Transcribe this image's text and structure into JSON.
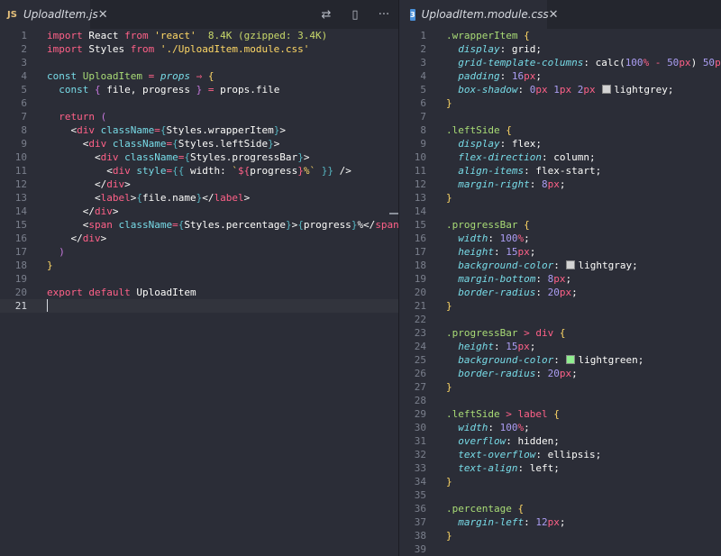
{
  "left_tab": {
    "icon": "JS",
    "name": "UploadItem.js",
    "close": "✕"
  },
  "left_actions": {
    "compare_icon": "⇄",
    "split_icon": "▯",
    "more_icon": "···"
  },
  "right_tab": {
    "icon": "3",
    "name": "UploadItem.module.css",
    "close": "✕"
  },
  "colors": {
    "lightgrey": "#d3d3d3",
    "lightgray": "#d3d3d3",
    "lightgreen": "#90ee90"
  },
  "left_lines": [
    {
      "n": "1",
      "parts": [
        [
          "kw",
          "import"
        ],
        [
          "id",
          " React "
        ],
        [
          "kw",
          "from"
        ],
        [
          "str",
          " 'react'"
        ],
        [
          "cm",
          "  8.4K (gzipped: 3.4K)"
        ]
      ]
    },
    {
      "n": "2",
      "parts": [
        [
          "kw",
          "import"
        ],
        [
          "id",
          " Styles "
        ],
        [
          "kw",
          "from"
        ],
        [
          "str",
          " './UploadItem.module.css'"
        ]
      ]
    },
    {
      "n": "3",
      "parts": []
    },
    {
      "n": "4",
      "parts": [
        [
          "attr",
          "const"
        ],
        [
          "fn",
          " UploadItem "
        ],
        [
          "op",
          "="
        ],
        [
          "prop",
          " props"
        ],
        [
          "op",
          " ⇒ "
        ],
        [
          "brace",
          "{"
        ]
      ]
    },
    {
      "n": "5",
      "parts": [
        [
          "id",
          "  "
        ],
        [
          "attr",
          "const"
        ],
        [
          "brace2",
          " { "
        ],
        [
          "id",
          "file, progress"
        ],
        [
          "brace2",
          " } "
        ],
        [
          "op",
          "="
        ],
        [
          "id",
          " props.file"
        ]
      ]
    },
    {
      "n": "6",
      "parts": []
    },
    {
      "n": "7",
      "parts": [
        [
          "id",
          "  "
        ],
        [
          "kw",
          "return"
        ],
        [
          "brace2",
          " ("
        ]
      ]
    },
    {
      "n": "8",
      "parts": [
        [
          "id",
          "    "
        ],
        [
          "id",
          "<"
        ],
        [
          "tag",
          "div"
        ],
        [
          "attr",
          " className"
        ],
        [
          "op",
          "="
        ],
        [
          "brace3",
          "{"
        ],
        [
          "id",
          "Styles.wrapperItem"
        ],
        [
          "brace3",
          "}"
        ],
        [
          "id",
          ">"
        ]
      ]
    },
    {
      "n": "9",
      "parts": [
        [
          "id",
          "      "
        ],
        [
          "id",
          "<"
        ],
        [
          "tag",
          "div"
        ],
        [
          "attr",
          " className"
        ],
        [
          "op",
          "="
        ],
        [
          "brace3",
          "{"
        ],
        [
          "id",
          "Styles.leftSide"
        ],
        [
          "brace3",
          "}"
        ],
        [
          "id",
          ">"
        ]
      ]
    },
    {
      "n": "10",
      "parts": [
        [
          "id",
          "        "
        ],
        [
          "id",
          "<"
        ],
        [
          "tag",
          "div"
        ],
        [
          "attr",
          " className"
        ],
        [
          "op",
          "="
        ],
        [
          "brace3",
          "{"
        ],
        [
          "id",
          "Styles.progressBar"
        ],
        [
          "brace3",
          "}"
        ],
        [
          "id",
          ">"
        ]
      ]
    },
    {
      "n": "11",
      "parts": [
        [
          "id",
          "          "
        ],
        [
          "id",
          "<"
        ],
        [
          "tag",
          "div"
        ],
        [
          "attr",
          " style"
        ],
        [
          "op",
          "="
        ],
        [
          "brace3",
          "{{"
        ],
        [
          "id",
          " width: "
        ],
        [
          "str",
          "`"
        ],
        [
          "op",
          "${"
        ],
        [
          "id",
          "progress"
        ],
        [
          "op",
          "}"
        ],
        [
          "str",
          "%`"
        ],
        [
          "brace3",
          " }}"
        ],
        [
          "id",
          " />"
        ]
      ]
    },
    {
      "n": "12",
      "parts": [
        [
          "id",
          "        "
        ],
        [
          "id",
          "</"
        ],
        [
          "tag",
          "div"
        ],
        [
          "id",
          ">"
        ]
      ]
    },
    {
      "n": "13",
      "parts": [
        [
          "id",
          "        "
        ],
        [
          "id",
          "<"
        ],
        [
          "tag",
          "label"
        ],
        [
          "id",
          ">"
        ],
        [
          "brace3",
          "{"
        ],
        [
          "id",
          "file.name"
        ],
        [
          "brace3",
          "}"
        ],
        [
          "id",
          "</"
        ],
        [
          "tag",
          "label"
        ],
        [
          "id",
          ">"
        ]
      ]
    },
    {
      "n": "14",
      "parts": [
        [
          "id",
          "      "
        ],
        [
          "id",
          "</"
        ],
        [
          "tag",
          "div"
        ],
        [
          "id",
          ">"
        ]
      ]
    },
    {
      "n": "15",
      "parts": [
        [
          "id",
          "      "
        ],
        [
          "id",
          "<"
        ],
        [
          "tag",
          "span"
        ],
        [
          "attr",
          " className"
        ],
        [
          "op",
          "="
        ],
        [
          "brace3",
          "{"
        ],
        [
          "id",
          "Styles.percentage"
        ],
        [
          "brace3",
          "}"
        ],
        [
          "id",
          ">"
        ],
        [
          "brace3",
          "{"
        ],
        [
          "id",
          "progress"
        ],
        [
          "brace3",
          "}"
        ],
        [
          "id",
          "%</"
        ],
        [
          "tag",
          "span"
        ],
        [
          "id",
          ">"
        ]
      ]
    },
    {
      "n": "16",
      "parts": [
        [
          "id",
          "    "
        ],
        [
          "id",
          "</"
        ],
        [
          "tag",
          "div"
        ],
        [
          "id",
          ">"
        ]
      ]
    },
    {
      "n": "17",
      "parts": [
        [
          "id",
          "  "
        ],
        [
          "brace2",
          ")"
        ]
      ]
    },
    {
      "n": "18",
      "parts": [
        [
          "brace",
          "}"
        ]
      ]
    },
    {
      "n": "19",
      "parts": []
    },
    {
      "n": "20",
      "parts": [
        [
          "kw",
          "export"
        ],
        [
          "kw",
          " default"
        ],
        [
          "id",
          " UploadItem"
        ]
      ]
    },
    {
      "n": "21",
      "parts": [],
      "active": true
    }
  ],
  "right_lines": [
    {
      "n": "1",
      "parts": [
        [
          "sel",
          ".wrapperItem"
        ],
        [
          "brace",
          " {"
        ]
      ]
    },
    {
      "n": "2",
      "parts": [
        [
          "id",
          "  "
        ],
        [
          "prop",
          "display"
        ],
        [
          "id",
          ": grid;"
        ]
      ]
    },
    {
      "n": "3",
      "parts": [
        [
          "id",
          "  "
        ],
        [
          "prop",
          "grid-template-columns"
        ],
        [
          "id",
          ": calc("
        ],
        [
          "num",
          "100"
        ],
        [
          "unit",
          "%"
        ],
        [
          "op",
          " - "
        ],
        [
          "num",
          "50"
        ],
        [
          "unit",
          "px"
        ],
        [
          "id",
          ") "
        ],
        [
          "num",
          "50"
        ],
        [
          "unit",
          "px"
        ],
        [
          "id",
          ";"
        ]
      ]
    },
    {
      "n": "4",
      "parts": [
        [
          "id",
          "  "
        ],
        [
          "prop",
          "padding"
        ],
        [
          "id",
          ": "
        ],
        [
          "num",
          "16"
        ],
        [
          "unit",
          "px"
        ],
        [
          "id",
          ";"
        ]
      ]
    },
    {
      "n": "5",
      "parts": [
        [
          "id",
          "  "
        ],
        [
          "prop",
          "box-shadow"
        ],
        [
          "id",
          ": "
        ],
        [
          "num",
          "0"
        ],
        [
          "unit",
          "px"
        ],
        [
          "id",
          " "
        ],
        [
          "num",
          "1"
        ],
        [
          "unit",
          "px"
        ],
        [
          "id",
          " "
        ],
        [
          "num",
          "2"
        ],
        [
          "unit",
          "px"
        ],
        [
          "id",
          " "
        ],
        [
          "swatch",
          "lightgrey"
        ],
        [
          "id",
          "lightgrey;"
        ]
      ]
    },
    {
      "n": "6",
      "parts": [
        [
          "brace",
          "}"
        ]
      ]
    },
    {
      "n": "7",
      "parts": []
    },
    {
      "n": "8",
      "parts": [
        [
          "sel",
          ".leftSide"
        ],
        [
          "brace",
          " {"
        ]
      ]
    },
    {
      "n": "9",
      "parts": [
        [
          "id",
          "  "
        ],
        [
          "prop",
          "display"
        ],
        [
          "id",
          ": flex;"
        ]
      ]
    },
    {
      "n": "10",
      "parts": [
        [
          "id",
          "  "
        ],
        [
          "prop",
          "flex-direction"
        ],
        [
          "id",
          ": column;"
        ]
      ]
    },
    {
      "n": "11",
      "parts": [
        [
          "id",
          "  "
        ],
        [
          "prop",
          "align-items"
        ],
        [
          "id",
          ": flex-start;"
        ]
      ]
    },
    {
      "n": "12",
      "parts": [
        [
          "id",
          "  "
        ],
        [
          "prop",
          "margin-right"
        ],
        [
          "id",
          ": "
        ],
        [
          "num",
          "8"
        ],
        [
          "unit",
          "px"
        ],
        [
          "id",
          ";"
        ]
      ]
    },
    {
      "n": "13",
      "parts": [
        [
          "brace",
          "}"
        ]
      ]
    },
    {
      "n": "14",
      "parts": []
    },
    {
      "n": "15",
      "parts": [
        [
          "sel",
          ".progressBar"
        ],
        [
          "brace",
          " {"
        ]
      ]
    },
    {
      "n": "16",
      "parts": [
        [
          "id",
          "  "
        ],
        [
          "prop",
          "width"
        ],
        [
          "id",
          ": "
        ],
        [
          "num",
          "100"
        ],
        [
          "unit",
          "%"
        ],
        [
          "id",
          ";"
        ]
      ]
    },
    {
      "n": "17",
      "parts": [
        [
          "id",
          "  "
        ],
        [
          "prop",
          "height"
        ],
        [
          "id",
          ": "
        ],
        [
          "num",
          "15"
        ],
        [
          "unit",
          "px"
        ],
        [
          "id",
          ";"
        ]
      ]
    },
    {
      "n": "18",
      "parts": [
        [
          "id",
          "  "
        ],
        [
          "prop",
          "background-color"
        ],
        [
          "id",
          ": "
        ],
        [
          "swatch",
          "lightgray"
        ],
        [
          "id",
          "lightgray;"
        ]
      ]
    },
    {
      "n": "19",
      "parts": [
        [
          "id",
          "  "
        ],
        [
          "prop",
          "margin-bottom"
        ],
        [
          "id",
          ": "
        ],
        [
          "num",
          "8"
        ],
        [
          "unit",
          "px"
        ],
        [
          "id",
          ";"
        ]
      ]
    },
    {
      "n": "20",
      "parts": [
        [
          "id",
          "  "
        ],
        [
          "prop",
          "border-radius"
        ],
        [
          "id",
          ": "
        ],
        [
          "num",
          "20"
        ],
        [
          "unit",
          "px"
        ],
        [
          "id",
          ";"
        ]
      ]
    },
    {
      "n": "21",
      "parts": [
        [
          "brace",
          "}"
        ]
      ]
    },
    {
      "n": "22",
      "parts": []
    },
    {
      "n": "23",
      "parts": [
        [
          "sel",
          ".progressBar"
        ],
        [
          "op",
          " > "
        ],
        [
          "tag",
          "div"
        ],
        [
          "brace",
          " {"
        ]
      ]
    },
    {
      "n": "24",
      "parts": [
        [
          "id",
          "  "
        ],
        [
          "prop",
          "height"
        ],
        [
          "id",
          ": "
        ],
        [
          "num",
          "15"
        ],
        [
          "unit",
          "px"
        ],
        [
          "id",
          ";"
        ]
      ]
    },
    {
      "n": "25",
      "parts": [
        [
          "id",
          "  "
        ],
        [
          "prop",
          "background-color"
        ],
        [
          "id",
          ": "
        ],
        [
          "swatch",
          "lightgreen"
        ],
        [
          "id",
          "lightgreen;"
        ]
      ]
    },
    {
      "n": "26",
      "parts": [
        [
          "id",
          "  "
        ],
        [
          "prop",
          "border-radius"
        ],
        [
          "id",
          ": "
        ],
        [
          "num",
          "20"
        ],
        [
          "unit",
          "px"
        ],
        [
          "id",
          ";"
        ]
      ]
    },
    {
      "n": "27",
      "parts": [
        [
          "brace",
          "}"
        ]
      ]
    },
    {
      "n": "28",
      "parts": []
    },
    {
      "n": "29",
      "parts": [
        [
          "sel",
          ".leftSide"
        ],
        [
          "op",
          " > "
        ],
        [
          "tag",
          "label"
        ],
        [
          "brace",
          " {"
        ]
      ]
    },
    {
      "n": "30",
      "parts": [
        [
          "id",
          "  "
        ],
        [
          "prop",
          "width"
        ],
        [
          "id",
          ": "
        ],
        [
          "num",
          "100"
        ],
        [
          "unit",
          "%"
        ],
        [
          "id",
          ";"
        ]
      ]
    },
    {
      "n": "31",
      "parts": [
        [
          "id",
          "  "
        ],
        [
          "prop",
          "overflow"
        ],
        [
          "id",
          ": hidden;"
        ]
      ]
    },
    {
      "n": "32",
      "parts": [
        [
          "id",
          "  "
        ],
        [
          "prop",
          "text-overflow"
        ],
        [
          "id",
          ": ellipsis;"
        ]
      ]
    },
    {
      "n": "33",
      "parts": [
        [
          "id",
          "  "
        ],
        [
          "prop",
          "text-align"
        ],
        [
          "id",
          ": left;"
        ]
      ]
    },
    {
      "n": "34",
      "parts": [
        [
          "brace",
          "}"
        ]
      ]
    },
    {
      "n": "35",
      "parts": []
    },
    {
      "n": "36",
      "parts": [
        [
          "sel",
          ".percentage"
        ],
        [
          "brace",
          " {"
        ]
      ]
    },
    {
      "n": "37",
      "parts": [
        [
          "id",
          "  "
        ],
        [
          "prop",
          "margin-left"
        ],
        [
          "id",
          ": "
        ],
        [
          "num",
          "12"
        ],
        [
          "unit",
          "px"
        ],
        [
          "id",
          ";"
        ]
      ]
    },
    {
      "n": "38",
      "parts": [
        [
          "brace",
          "}"
        ]
      ]
    },
    {
      "n": "39",
      "parts": []
    }
  ]
}
